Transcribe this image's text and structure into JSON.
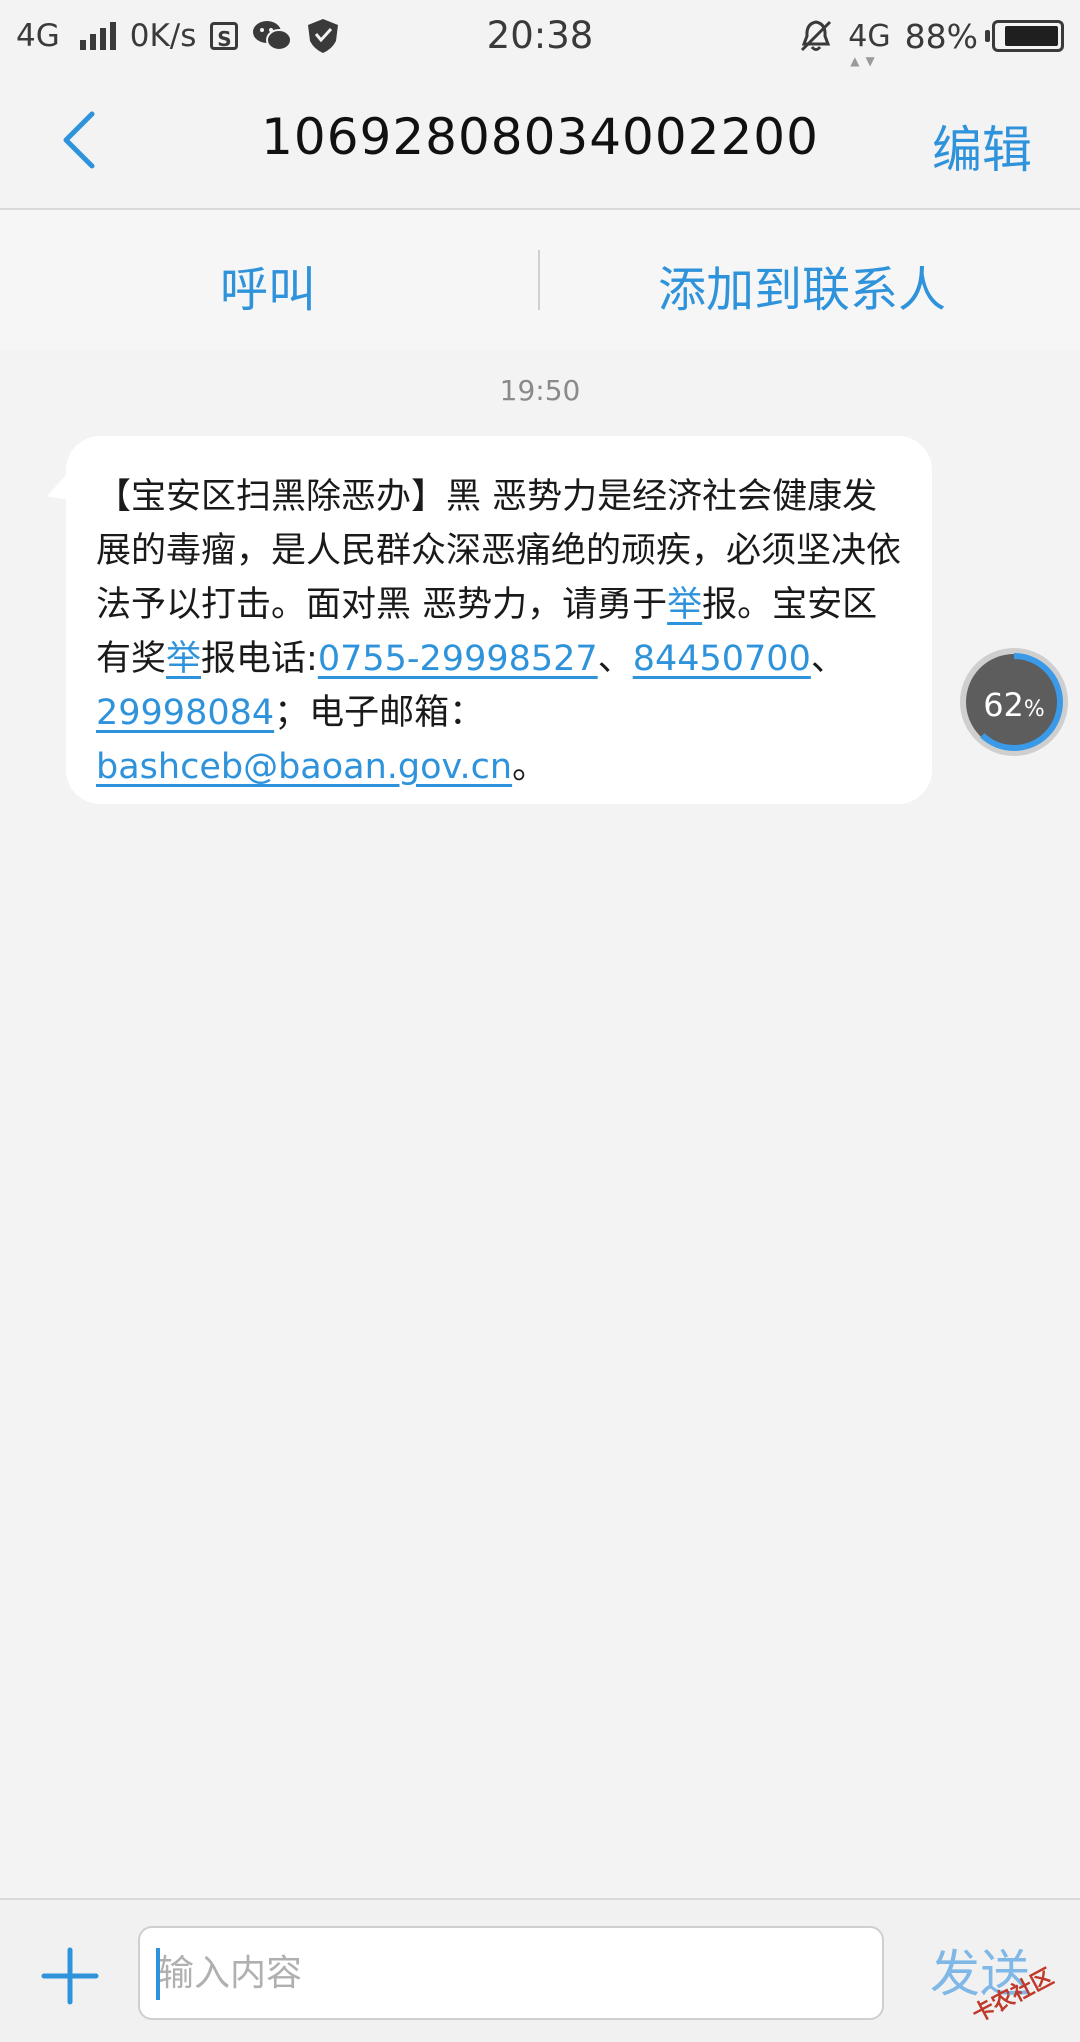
{
  "status_bar": {
    "network": "4G",
    "speed": "0K/s",
    "time": "20:38",
    "network_right": "4G",
    "battery": "88%",
    "battery_level": 0.88
  },
  "header": {
    "title": "10692808034002200",
    "edit_label": "编辑"
  },
  "actions": {
    "call_label": "呼叫",
    "add_contact_label": "添加到联系人"
  },
  "conversation": {
    "timestamp": "19:50",
    "message": {
      "t1": "【宝安区扫黑除恶办】黑 恶势力是经济社会健康发展的毒瘤，是人民群众深恶痛绝的顽疾，必须坚决依法予以打击。面对黑 恶势力，请勇于",
      "l1": "举",
      "t2": "报。宝安区有奖",
      "l2": "举",
      "t3": "报电话:",
      "phone1": "0755-29998527",
      "sep1": "、",
      "phone2": "84450700",
      "sep2": "、",
      "phone3": "29998084",
      "t4": "；电子邮箱：",
      "email": "bashceb@baoan.gov.cn",
      "t5": "。"
    }
  },
  "floating_widget": {
    "value": "62",
    "unit": "%",
    "fraction": 0.62
  },
  "composer": {
    "placeholder": "输入内容",
    "send_label": "发送",
    "watermark": "卡农社区"
  },
  "colors": {
    "accent": "#2f93db",
    "background": "#f3f3f3",
    "bubble": "#ffffff"
  }
}
